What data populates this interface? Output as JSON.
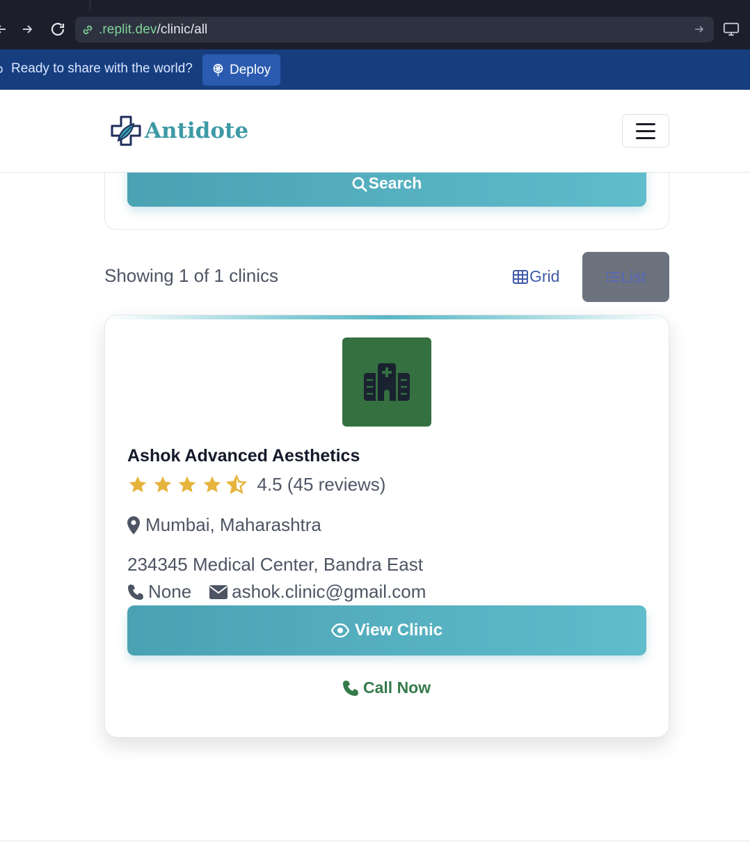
{
  "browser": {
    "url_host": ".replit.dev",
    "url_path": "/clinic/all"
  },
  "replit_banner": {
    "message": "Ready to share with the world?",
    "deploy_label": "Deploy"
  },
  "header": {
    "brand": "Antidote"
  },
  "search": {
    "button_label": "Search"
  },
  "results": {
    "count_text": "Showing 1 of 1 clinics",
    "grid_label": "Grid",
    "list_label": "List"
  },
  "clinic": {
    "name": "Ashok Advanced Aesthetics",
    "rating": 4.5,
    "rating_text": "4.5 (45 reviews)",
    "location": "Mumbai, Maharashtra",
    "address": "234345 Medical Center, Bandra East",
    "phone": "None",
    "email": "ashok.clinic@gmail.com",
    "view_label": "View Clinic",
    "call_label": "Call Now",
    "logo_icon": "hospital-icon"
  },
  "colors": {
    "brand": "#3d9aa6",
    "star": "#e6b43c",
    "clinic_logo_bg": "#357040",
    "call_green": "#357a4b",
    "replit_bar": "#163e7f"
  }
}
